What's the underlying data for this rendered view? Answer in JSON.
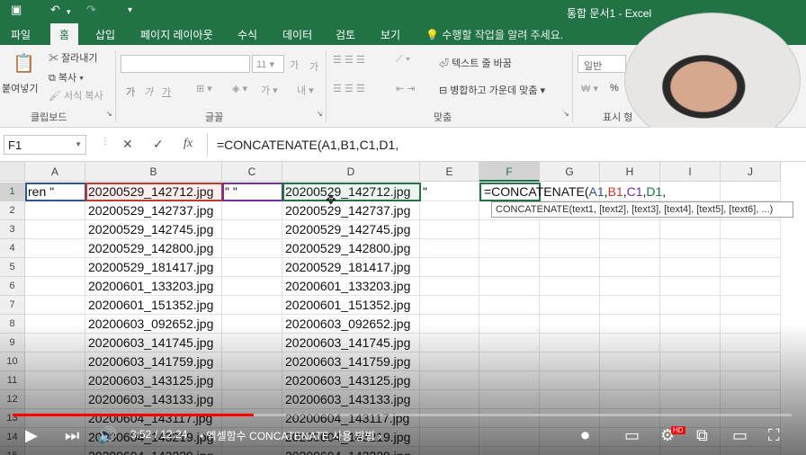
{
  "window": {
    "title": "통합 문서1  -  Excel"
  },
  "qat": {
    "save_icon": "save-icon",
    "undo": "↶",
    "redo": "↷",
    "customize": "▾"
  },
  "tabs": [
    "파일",
    "홈",
    "삽입",
    "페이지 레이아웃",
    "수식",
    "데이터",
    "검토",
    "보기"
  ],
  "active_tab": "홈",
  "tellme": "수행할 작업을 알려 주세요.",
  "ribbon": {
    "clipboard": {
      "paste": "붙여넣기",
      "cut": "잘라내기",
      "copy": "복사",
      "format_painter": "서식 복사",
      "group": "클립보드"
    },
    "font": {
      "size": "11",
      "bold": "가",
      "italic": "가",
      "underline": "가",
      "group": "글꼴",
      "grow": "가",
      "shrink": "가"
    },
    "alignment": {
      "wrap": "텍스트 줄 바꿈",
      "merge": "병합하고 가운데 맞춤",
      "group": "맞춤"
    },
    "number": {
      "format": "일반",
      "percent": "%",
      "group": "표시 형"
    }
  },
  "formula_bar": {
    "name_box": "F1",
    "cancel": "✕",
    "enter": "✓",
    "fx": "fx",
    "formula": "=CONCATENATE(A1,B1,C1,D1,"
  },
  "columns": [
    "A",
    "B",
    "C",
    "D",
    "E",
    "F",
    "G",
    "H",
    "I",
    "J"
  ],
  "selected_column": "F",
  "rows": [
    {
      "n": "1",
      "a": "ren \"",
      "b": "20200529_142712.jpg",
      "c": "\" \"",
      "d": "20200529_142712.jpg",
      "e": "\""
    },
    {
      "n": "2",
      "b": "20200529_142737.jpg",
      "d": "20200529_142737.jpg"
    },
    {
      "n": "3",
      "b": "20200529_142745.jpg",
      "d": "20200529_142745.jpg"
    },
    {
      "n": "4",
      "b": "20200529_142800.jpg",
      "d": "20200529_142800.jpg"
    },
    {
      "n": "5",
      "b": "20200529_181417.jpg",
      "d": "20200529_181417.jpg"
    },
    {
      "n": "6",
      "b": "20200601_133203.jpg",
      "d": "20200601_133203.jpg"
    },
    {
      "n": "7",
      "b": "20200601_151352.jpg",
      "d": "20200601_151352.jpg"
    },
    {
      "n": "8",
      "b": "20200603_092652.jpg",
      "d": "20200603_092652.jpg"
    },
    {
      "n": "9",
      "b": "20200603_141745.jpg",
      "d": "20200603_141745.jpg"
    },
    {
      "n": "10",
      "b": "20200603_141759.jpg",
      "d": "20200603_141759.jpg"
    },
    {
      "n": "11",
      "b": "20200603_143125.jpg",
      "d": "20200603_143125.jpg"
    },
    {
      "n": "12",
      "b": "20200603_143133.jpg",
      "d": "20200603_143133.jpg"
    },
    {
      "n": "13",
      "b": "20200604_143117.jpg",
      "d": "20200604_143117.jpg"
    },
    {
      "n": "14",
      "b": "20200604_143219.jpg",
      "d": "20200604_143219.jpg"
    },
    {
      "n": "15",
      "b": "20200604_143229.jpg",
      "d": "20200604_143229.jpg"
    }
  ],
  "active_cell": {
    "prefix": "=CONCATENATE(",
    "refs": [
      {
        "text": "A1",
        "color": "#2f5597"
      },
      {
        "text": ",",
        "color": "#111111"
      },
      {
        "text": "B1",
        "color": "#c0392b"
      },
      {
        "text": ",",
        "color": "#111111"
      },
      {
        "text": "C1",
        "color": "#7030a0"
      },
      {
        "text": ",",
        "color": "#111111"
      },
      {
        "text": "D1",
        "color": "#217346"
      },
      {
        "text": ",",
        "color": "#111111"
      }
    ]
  },
  "tooltip": "CONCATENATE(text1, [text2], [text3], [text4], [text5], [text6], ...)",
  "colors": {
    "excel_green": "#217346",
    "ref_a": "#2f5597",
    "ref_b": "#c0392b",
    "ref_c": "#7030a0",
    "ref_d": "#217346",
    "progress_red": "#ff0000"
  },
  "player": {
    "time": "3:52 / 12:24",
    "chapter": "• 엑셀함수 CONCATENATE 사용 방법 ›",
    "progress": 0.31,
    "hd_badge": "HD"
  }
}
